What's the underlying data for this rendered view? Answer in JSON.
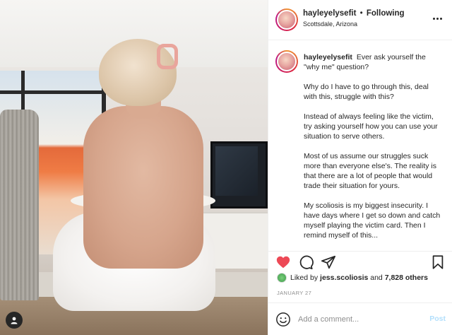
{
  "post": {
    "username": "hayleyelysefit",
    "separator": "•",
    "follow_status": "Following",
    "location": "Scottsdale, Arizona"
  },
  "caption": {
    "username": "hayleyelysefit",
    "paragraphs": [
      "Ever ask yourself the \"why me\" question?",
      "Why do I have to go through this, deal with this, struggle with this?",
      "Instead of always feeling like the victim, try asking yourself how you can use your situation to serve others.",
      "Most of us assume our struggles suck more than everyone else's. The reality is that there are a lot of people that would trade their situation for yours.",
      "My scoliosis is my biggest insecurity. I have days where I get so down and catch myself playing the victim card. Then I remind myself of this..."
    ]
  },
  "likes": {
    "prefix": "Liked by",
    "user": "jess.scoliosis",
    "and": "and",
    "count": "7,828 others"
  },
  "date": "JANUARY 27",
  "comment": {
    "placeholder": "Add a comment...",
    "post_label": "Post"
  },
  "icons": {
    "like": "heart-icon",
    "comment": "comment-icon",
    "share": "paper-plane-icon",
    "save": "bookmark-icon",
    "emoji": "smiley-icon",
    "more": "more-options-icon",
    "profile": "profile-icon"
  },
  "colors": {
    "like_red": "#ed4956",
    "text": "#262626",
    "muted": "#8e8e8e",
    "post_disabled": "#b2dffc"
  }
}
